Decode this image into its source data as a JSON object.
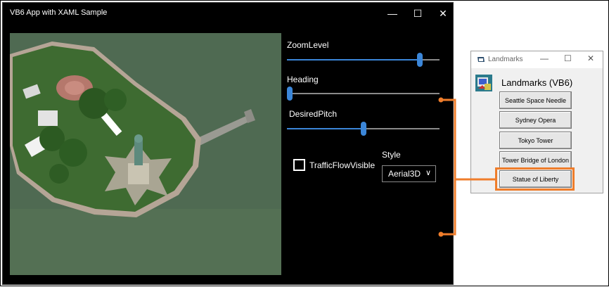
{
  "xaml_window": {
    "title": "VB6 App with XAML Sample",
    "minimize_glyph": "—",
    "maximize_glyph": "☐",
    "close_glyph": "✕",
    "zoom": {
      "label": "ZoomLevel",
      "level": 0.87
    },
    "heading": {
      "label": "Heading",
      "level": 0.0
    },
    "pitch": {
      "label": "DesiredPitch",
      "level": 0.5
    },
    "traffic": {
      "label": "TrafficFlowVisible",
      "checked": false
    },
    "style": {
      "label": "Style",
      "value": "Aerial3D",
      "chevron": "∨"
    }
  },
  "vb6_window": {
    "title": "Landmarks",
    "minimize_glyph": "—",
    "maximize_glyph": "☐",
    "close_glyph": "✕",
    "heading": "Landmarks (VB6)",
    "buttons": [
      "Seattle Space Needle",
      "Sydney Opera",
      "Tokyo Tower",
      "Tower Bridge of London",
      "Statue of Liberty"
    ]
  },
  "colors": {
    "accent": "#3b86d8",
    "annotation": "#ef7d2b",
    "water": "#4f6a52",
    "island": "#3d6b2f"
  }
}
